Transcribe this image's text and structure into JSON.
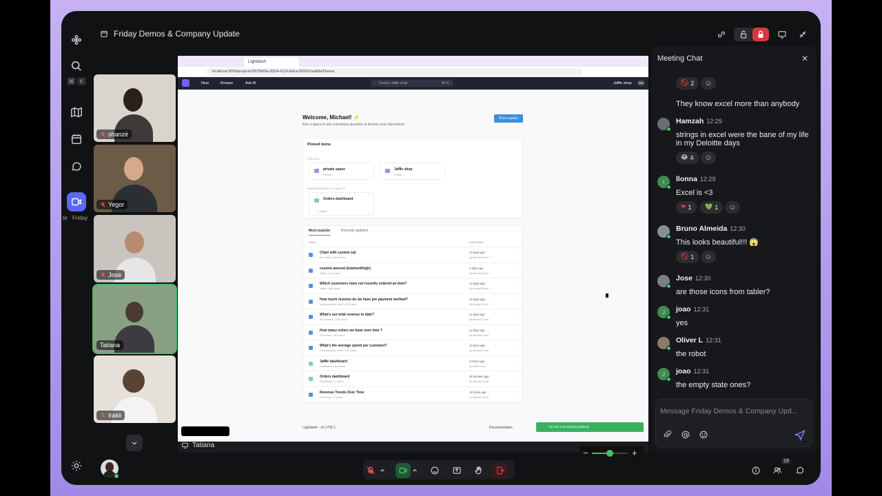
{
  "window": {
    "title": "Friday Demos & Company Update"
  },
  "rail": {
    "kbd_keys": [
      "⌘",
      "K"
    ],
    "active_label_left": "te",
    "active_label_right": "Friday"
  },
  "participants": [
    {
      "name": "shanzé",
      "mic": "muted"
    },
    {
      "name": "Yegor",
      "mic": "muted"
    },
    {
      "name": "Jose",
      "mic": "muted"
    },
    {
      "name": "Tatiana",
      "mic": "active"
    },
    {
      "name": "Irakli",
      "mic": "muted"
    }
  ],
  "presenter": {
    "name": "Tatiana"
  },
  "browser": {
    "tab_title": "Lightdash",
    "url": "localhost:3000/projects/3675b69e-8324-4110-bdca-059031aa8da3/home"
  },
  "lightdash": {
    "nav": {
      "new": "New",
      "browse": "Browse",
      "ask_ai": "Ask AI",
      "search_placeholder": "Search Jaffle shop",
      "search_shortcut": "⌘+K",
      "project": "Jaffle shop",
      "user_initials": "MS"
    },
    "welcome_title": "Welcome, Michael! ⚡",
    "welcome_subtitle": "Run a query to ask a business question or browse your data below:",
    "run_query": "Run a query",
    "pinned": {
      "title": "Pinned items",
      "spaces_label": "SPACES",
      "spaces": [
        {
          "name": "private space",
          "meta": "Private"
        },
        {
          "name": "Jaffle shop",
          "meta": "Public"
        }
      ],
      "dash_label": "DASHBOARDS & CHARTS",
      "dashboards": [
        {
          "name": "Orders dashboard",
          "meta": "7 views"
        }
      ]
    },
    "list": {
      "tabs": [
        "Most popular",
        "Recently updated"
      ],
      "col_name": "Name",
      "col_edited": "Last Edited",
      "rows": [
        {
          "name": "Chart with custom sql",
          "sub": "Bar chart • 1619 views",
          "edited": "14 days ago",
          "by": "by Michael Scott",
          "kind": "bar"
        },
        {
          "name": "custom amount (low/med/high)",
          "sub": "Table • 114 views",
          "edited": "4 days ago",
          "by": "by Michael Scott",
          "kind": "table"
        },
        {
          "name": "Which customers have not recently ordered an item?",
          "sub": "Table • 166 views",
          "edited": "14 days ago",
          "by": "by Michael Scott",
          "kind": "table"
        },
        {
          "name": "How much revenue do we have per payment method?",
          "sub": "Horizontal bar chart • 143 views",
          "edited": "14 days ago",
          "by": "by Michael Scott",
          "kind": "bar"
        },
        {
          "name": "What's our total revenue to date?",
          "sub": "Big number • 195 views",
          "edited": "14 days ago",
          "by": "by Michael Scott",
          "kind": "table"
        },
        {
          "name": "How many orders we have over time ?",
          "sub": "Line chart • 103 views",
          "edited": "14 days ago",
          "by": "by Michael Scott",
          "kind": "line"
        },
        {
          "name": "What's the average spend per customer?",
          "sub": "Horizontal bar chart • 101 views",
          "edited": "14 days ago",
          "by": "by Michael Scott",
          "kind": "bar"
        },
        {
          "name": "Jaffle dashboard",
          "sub": "Dashboard • 60 views",
          "edited": "2 hours ago",
          "by": "by Editor User",
          "kind": "dash"
        },
        {
          "name": "Orders dashboard",
          "sub": "Dashboard • 7 views",
          "edited": "30 minutes ago",
          "by": "by Michael Scott",
          "kind": "dash"
        },
        {
          "name": "Revenue Trends Over Time",
          "sub": "Line chart • 3 views",
          "edited": "16 hours ago",
          "by": "by Michael Scott",
          "kind": "line"
        }
      ]
    },
    "footer_version": "Lightdash - v0.1735.1",
    "footer_docs": "Documentation",
    "toast": "You are now sharing (tatiana)"
  },
  "zoom": {
    "level": 0.5
  },
  "chat": {
    "title": "Meeting Chat",
    "messages": [
      {
        "type": "reactions",
        "reactions": [
          {
            "emoji": "🚫",
            "count": "2"
          }
        ]
      },
      {
        "type": "text",
        "text": "They know excel more than anybody"
      },
      {
        "type": "msg",
        "author": "Hamzah",
        "time": "12:29",
        "text": "strings in excel were the bane of my life in my Deloitte days",
        "reactions": [
          {
            "emoji": "😂",
            "count": "4"
          }
        ]
      },
      {
        "type": "msg",
        "author": "llonna",
        "time": "12:29",
        "text": "Excel is <3",
        "avatar_letter": "I",
        "reactions": [
          {
            "emoji": "❤",
            "count": "1"
          },
          {
            "emoji": "💚",
            "count": "1"
          }
        ]
      },
      {
        "type": "msg",
        "author": "Bruno Almeida",
        "time": "12:30",
        "text": "This looks beautiful!!! 😱",
        "reactions": [
          {
            "emoji": "🚫",
            "count": "1"
          }
        ]
      },
      {
        "type": "msg",
        "author": "Jose",
        "time": "12:30",
        "text": "are those icons from tabler?"
      },
      {
        "type": "msg",
        "author": "joao",
        "time": "12:31",
        "text": "yes",
        "avatar_letter": "J"
      },
      {
        "type": "msg",
        "author": "Oliver L",
        "time": "12:31",
        "text": "the robot"
      },
      {
        "type": "msg",
        "author": "joao",
        "time": "12:31",
        "text": "the empty state ones?",
        "avatar_letter": "J"
      }
    ],
    "composer_placeholder": "Message Friday Demos & Company Upd..."
  },
  "bottom": {
    "participants_count": "19"
  },
  "colors": {
    "accent": "#5b67f5",
    "active_tile": "#46c06a",
    "danger": "#d9363e",
    "lightdash_nav": "#1f2430",
    "lightdash_primary": "#3b8fe0"
  }
}
